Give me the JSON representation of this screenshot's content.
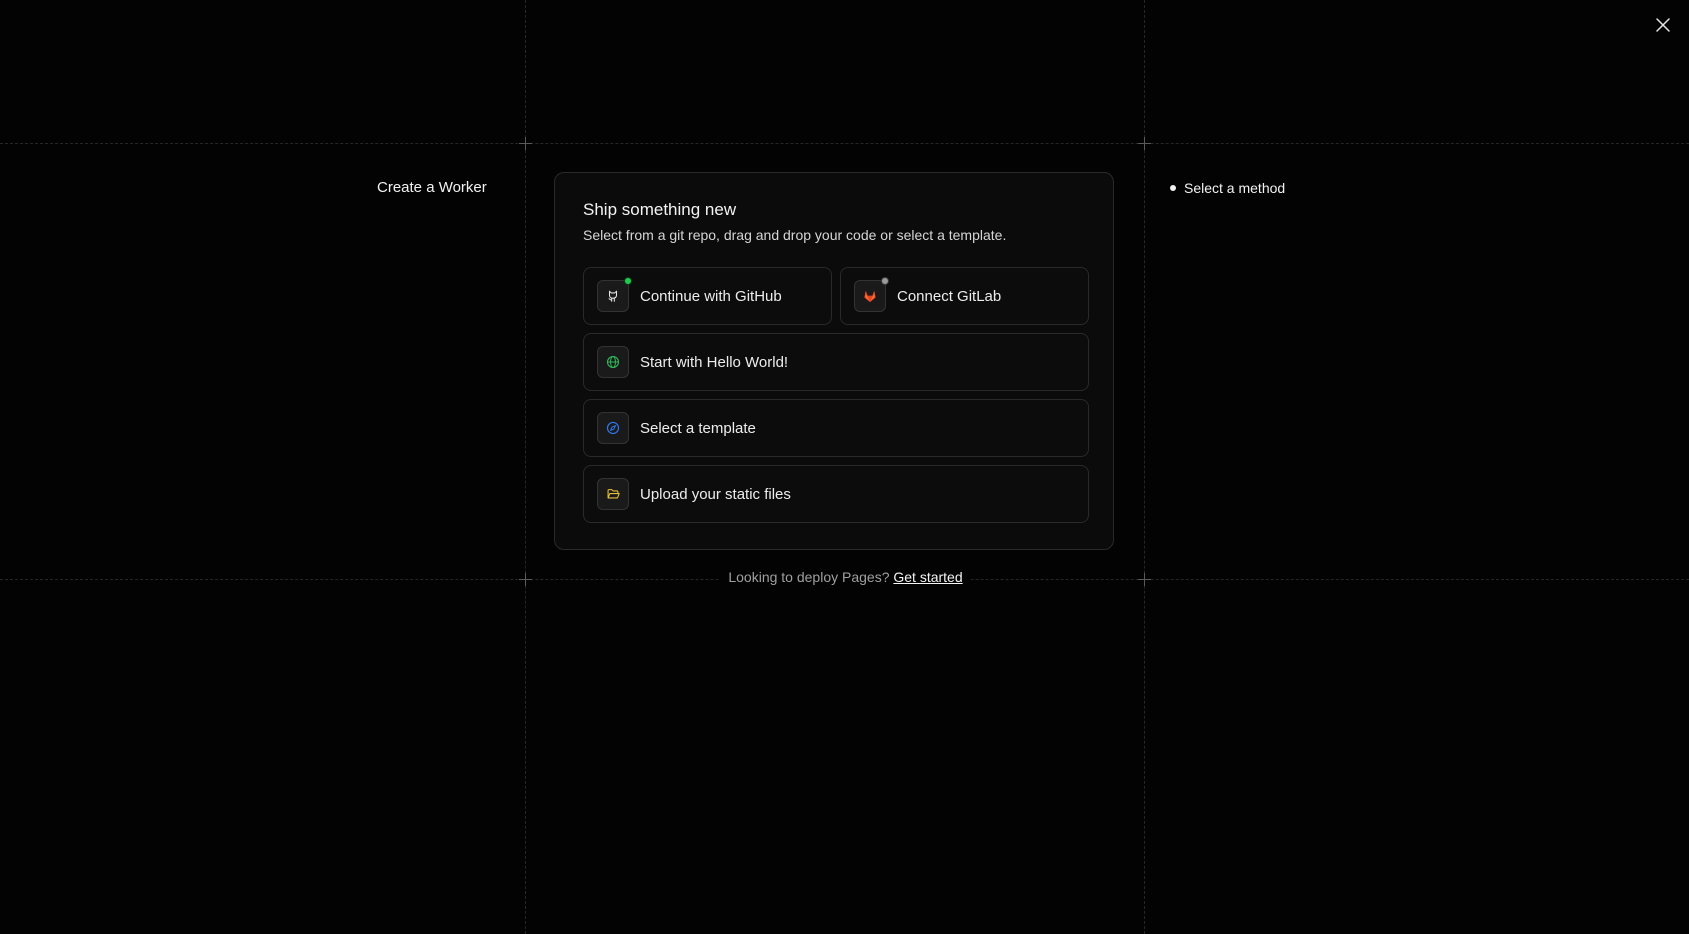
{
  "header": {
    "page_title": "Create a Worker"
  },
  "steps": [
    {
      "label": "Select a method",
      "active": true
    }
  ],
  "card": {
    "title": "Ship something new",
    "subtitle": "Select from a git repo, drag and drop your code or select a template.",
    "options": [
      {
        "label": "Continue with GitHub",
        "icon": "github-icon",
        "status": "connected"
      },
      {
        "label": "Connect GitLab",
        "icon": "gitlab-icon",
        "status": "disconnected"
      },
      {
        "label": "Start with Hello World!",
        "icon": "globe-icon"
      },
      {
        "label": "Select a template",
        "icon": "compass-icon"
      },
      {
        "label": "Upload your static files",
        "icon": "folder-icon"
      }
    ]
  },
  "footer": {
    "text": "Looking to deploy Pages?",
    "link": "Get started"
  },
  "colors": {
    "background": "#030303",
    "card": "#0b0b0b",
    "border": "#2a2a2a",
    "github_status": "#1fcc4d",
    "gitlab": "#fc6d26",
    "globe": "#2fbf5a",
    "compass": "#2f7bf5",
    "folder": "#e8c23a"
  }
}
